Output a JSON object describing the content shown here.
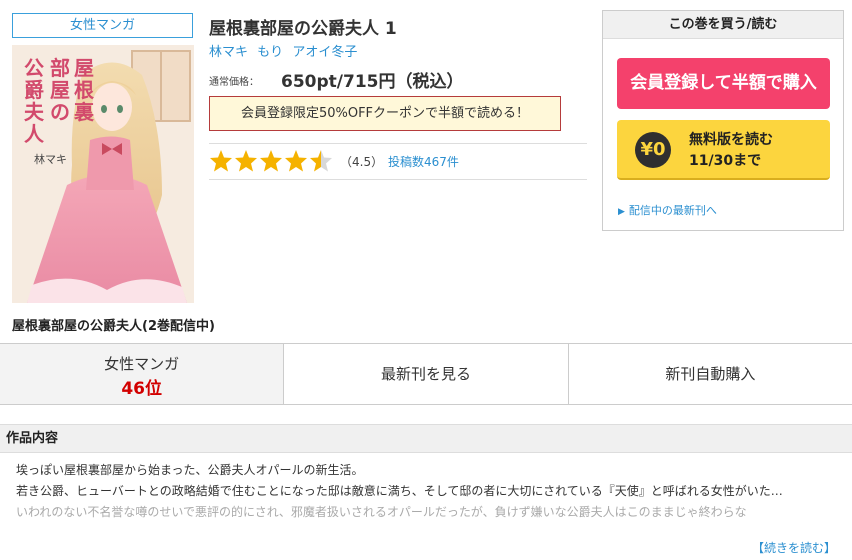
{
  "genre_tag": "女性マンガ",
  "cover": {
    "title_vertical": [
      "屋根裏",
      "部屋の",
      "公爵夫人"
    ],
    "author": "林マキ"
  },
  "series_title": "屋根裏部屋の公爵夫人(2巻配信中)",
  "book": {
    "title": "屋根裏部屋の公爵夫人 1",
    "authors": [
      "林マキ",
      "もり",
      "アオイ冬子"
    ],
    "price_label": "通常価格：",
    "price": "650pt/715円（税込）",
    "coupon_text": "会員登録限定50%OFFクーポンで半額で読める！",
    "rating_value": 4.5,
    "rating_text": "（4.5）",
    "reviews_text": "投稿数467件"
  },
  "buybox": {
    "header": "この巻を買う/読む",
    "half_price_button": "会員登録して半額で購入",
    "free_coin": "¥0",
    "free_line1": "無料版を読む",
    "free_line2": "11/30まで",
    "latest_link": "配信中の最新刊へ"
  },
  "actions": {
    "rank_genre": "女性マンガ",
    "rank_position": "46位",
    "latest_volume": "最新刊を見る",
    "auto_purchase": "新刊自動購入"
  },
  "synopsis": {
    "heading": "作品内容",
    "lines": [
      "埃っぽい屋根裏部屋から始まった、公爵夫人オパールの新生活。",
      "若き公爵、ヒューバートとの政略結婚で住むことになった邸は敵意に満ち、そして邸の者に大切にされている『天使』と呼ばれる女性がいた…",
      "いわれのない不名誉な噂のせいで悪評の的にされ、邪魔者扱いされるオパールだったが、負けず嫌いな公爵夫人はこのままじゃ終わらな"
    ],
    "read_more": "【続きを読む】"
  },
  "colors": {
    "accent_blue": "#2b8fd0",
    "buy_pink": "#f4416c",
    "free_yellow": "#fcd53e",
    "rank_red": "#d20000",
    "star": "#f5b200"
  }
}
